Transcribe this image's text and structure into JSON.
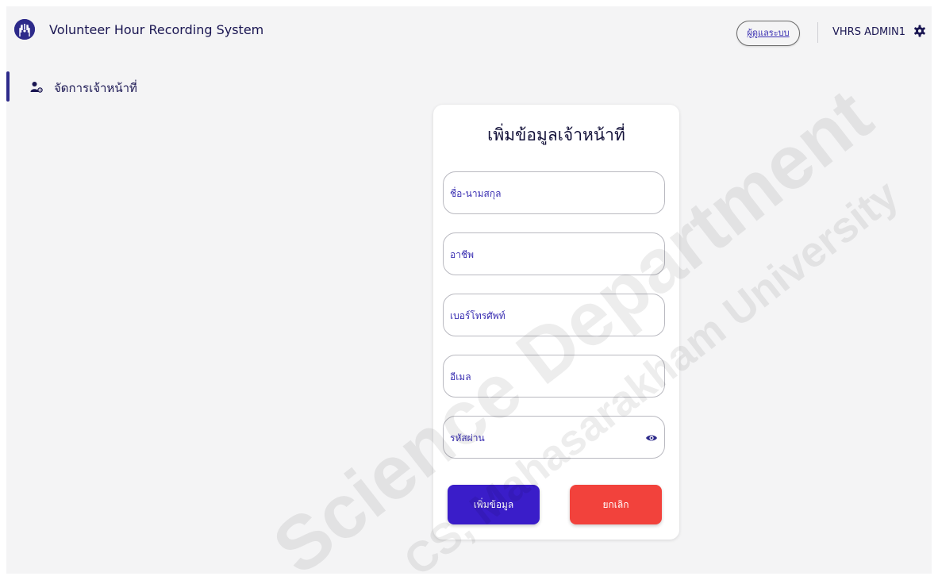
{
  "header": {
    "app_title": "Volunteer Hour Recording System",
    "role_label": "ผู้ดูแลระบบ",
    "user_name": "VHRS ADMIN1"
  },
  "sidebar": {
    "items": [
      {
        "label": "จัดการเจ้าหน้าที่",
        "icon": "user-gear-icon",
        "active": true
      }
    ]
  },
  "form": {
    "title": "เพิ่มข้อมูลเจ้าหน้าที่",
    "fields": [
      {
        "placeholder": "ชื่อ-นามสกุล",
        "value": ""
      },
      {
        "placeholder": "อาชีพ",
        "value": ""
      },
      {
        "placeholder": "เบอร์โทรศัพท์",
        "value": ""
      },
      {
        "placeholder": "อีเมล",
        "value": ""
      },
      {
        "placeholder": "รหัสผ่าน",
        "value": ""
      }
    ],
    "submit_label": "เพิ่มข้อมูล",
    "cancel_label": "ยกเลิก"
  },
  "watermark": {
    "line1": "Science Department",
    "line2": "CS, Mahasarakham University"
  },
  "colors": {
    "brand": "#2d2a8a",
    "primary_button": "#3a1dc9",
    "danger_button": "#f2423c",
    "accent_text": "#3a2fb2"
  }
}
